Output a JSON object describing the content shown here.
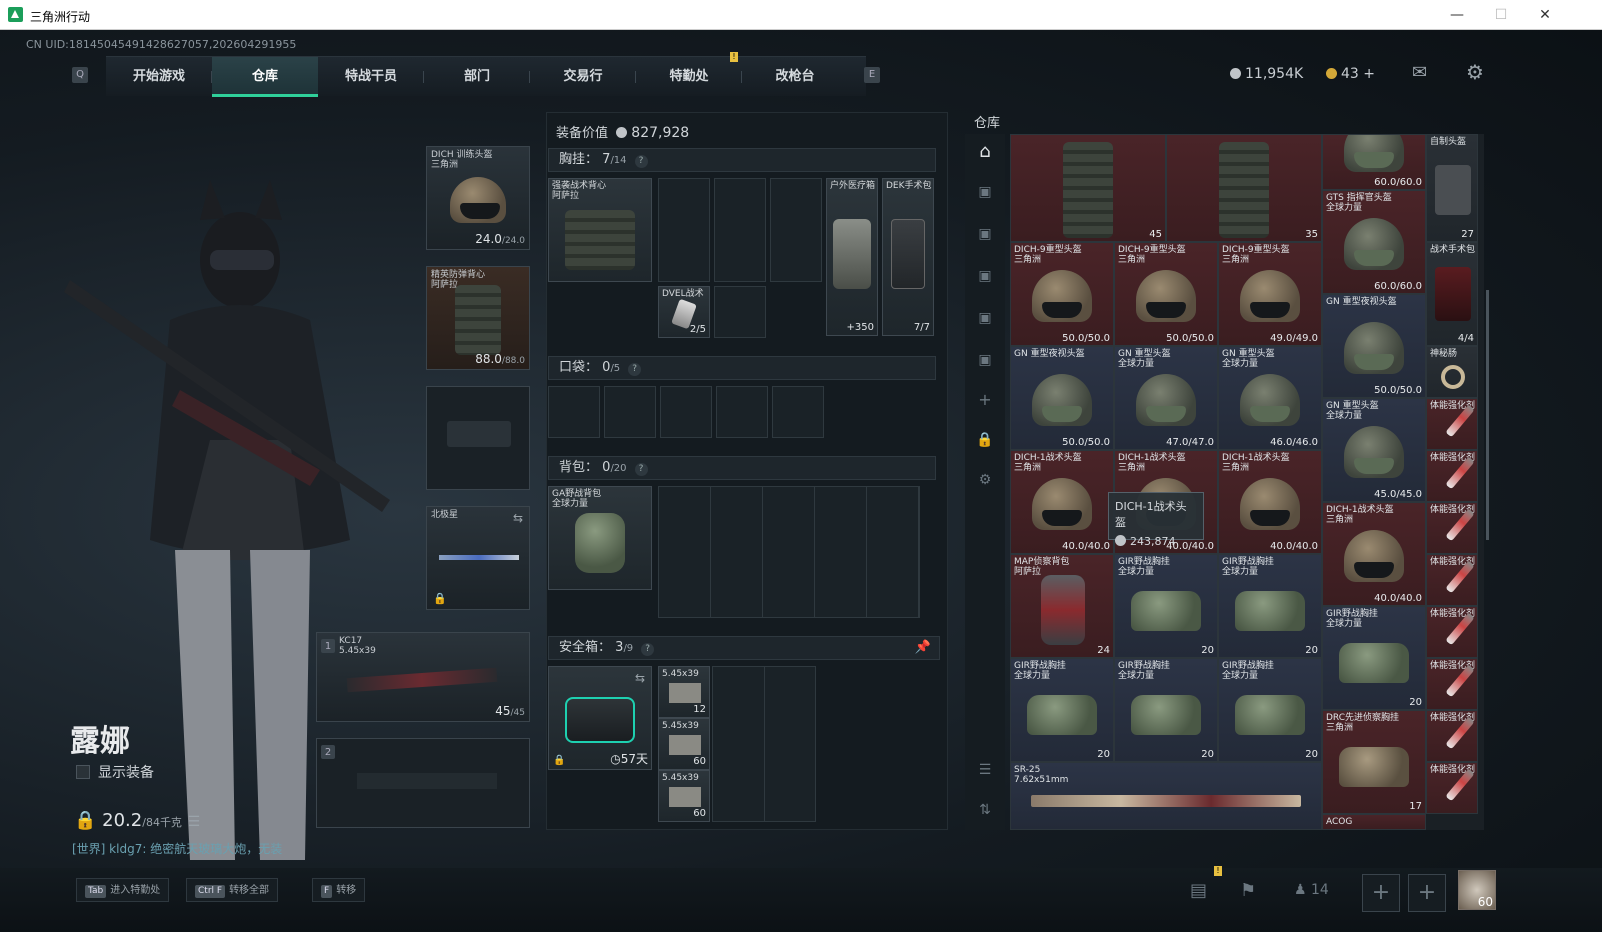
{
  "window": {
    "title": "三角洲行动"
  },
  "uid": "CN UID:1814504549142862705​7,202604291955",
  "nav": {
    "key_left": "Q",
    "key_right": "E",
    "tabs": [
      "开始游戏",
      "仓库",
      "特战干员",
      "部门",
      "交易行",
      "特勤处",
      "改枪台"
    ],
    "active": "仓库"
  },
  "currency": {
    "coins": "11,954K",
    "tickets": "43"
  },
  "character": {
    "name": "露娜",
    "show_equip": "显示装备",
    "weight": "20.2",
    "weight_max": "/84千克",
    "chat": "[世界] kldg7: 绝密航天玻璃大炮，无装"
  },
  "equip_slots": {
    "helmet": {
      "name": "DICH 训练头盔",
      "sub": "三角洲",
      "dur": "24.0",
      "dur_max": "/24.0"
    },
    "armor": {
      "name": "精英防弹背心",
      "sub": "阿萨拉",
      "dur": "88.0",
      "dur_max": "/88.0"
    },
    "melee": {
      "name": "北极星"
    },
    "primary": {
      "num": "1",
      "name": "KC17",
      "caliber": "5.45x39",
      "ammo": "45",
      "ammo_max": "/45"
    },
    "secondary": {
      "num": "2"
    }
  },
  "loadout": {
    "value_label": "装备价值",
    "value": "827,928",
    "chest": {
      "label": "胸挂：",
      "count": "7",
      "max": "/14",
      "rig_name": "强袭战术背心",
      "rig_sub": "阿萨拉",
      "medkit": "户外医疗箱",
      "medkit_val": "350",
      "surgkit": "DEK手术包",
      "surgkit_val": "7/7",
      "battery": "DVEL战术",
      "battery_val": "2/5"
    },
    "pocket": {
      "label": "口袋：",
      "count": "0",
      "max": "/5"
    },
    "backpack": {
      "label": "背包：",
      "count": "0",
      "max": "/20",
      "bag_name": "GA野战背包",
      "bag_sub": "全球力量"
    },
    "safe": {
      "label": "安全箱：",
      "count": "3",
      "max": "/9",
      "days": "57天",
      "ammo": [
        {
          "name": "5.45x39",
          "qty": "12"
        },
        {
          "name": "5.45x39",
          "qty": "60"
        },
        {
          "name": "5.45x39",
          "qty": "60"
        }
      ]
    }
  },
  "warehouse": {
    "title": "仓库",
    "tooltip": {
      "name": "DICH-1战术头盔",
      "value": "243,874"
    },
    "items": [
      {
        "name": "",
        "sub": "",
        "qty": "45"
      },
      {
        "name": "",
        "sub": "",
        "qty": "35"
      },
      {
        "name": "",
        "sub": "",
        "qty": "60.0/60.0"
      },
      {
        "name": "自制头盔",
        "sub": "",
        "qty": "27"
      },
      {
        "name": "GTS 指挥官头盔",
        "sub": "全球力量",
        "qty": "60.0/60.0"
      },
      {
        "name": "战术手术包",
        "sub": "",
        "qty": "4/4"
      },
      {
        "name": "DICH-9重型头盔",
        "sub": "三角洲",
        "qty": "50.0/50.0"
      },
      {
        "name": "DICH-9重型头盔",
        "sub": "三角洲",
        "qty": "50.0/50.0"
      },
      {
        "name": "DICH-9重型头盔",
        "sub": "三角洲",
        "qty": "49.0/49.0"
      },
      {
        "name": "GN 重型夜视头盔",
        "sub": "",
        "qty": "50.0/50.0"
      },
      {
        "name": "神秘肠",
        "sub": "",
        "qty": ""
      },
      {
        "name": "GN 重型夜视头盔",
        "sub": "",
        "qty": "50.0/50.0"
      },
      {
        "name": "GN 重型头盔",
        "sub": "全球力量",
        "qty": "47.0/47.0"
      },
      {
        "name": "GN 重型头盔",
        "sub": "全球力量",
        "qty": "46.0/46.0"
      },
      {
        "name": "GN 重型头盔",
        "sub": "全球力量",
        "qty": "45.0/45.0"
      },
      {
        "name": "体能强化剂",
        "sub": "",
        "qty": ""
      },
      {
        "name": "DICH-1战术头盔",
        "sub": "三角洲",
        "qty": "40.0/40.0"
      },
      {
        "name": "DICH-1战术头盔",
        "sub": "三角洲",
        "qty": "40.0/40.0"
      },
      {
        "name": "DICH-1战术头盔",
        "sub": "三角洲",
        "qty": "40.0/40.0"
      },
      {
        "name": "DICH-1战术头盔",
        "sub": "三角洲",
        "qty": "40.0/40.0"
      },
      {
        "name": "MAP侦察背包",
        "sub": "阿萨拉",
        "qty": "24"
      },
      {
        "name": "GIR野战胸挂",
        "sub": "全球力量",
        "qty": "20"
      },
      {
        "name": "GIR野战胸挂",
        "sub": "全球力量",
        "qty": "20"
      },
      {
        "name": "GIR野战胸挂",
        "sub": "全球力量",
        "qty": "20"
      },
      {
        "name": "GIR野战胸挂",
        "sub": "全球力量",
        "qty": "20"
      },
      {
        "name": "GIR野战胸挂",
        "sub": "全球力量",
        "qty": "20"
      },
      {
        "name": "GIR野战胸挂",
        "sub": "全球力量",
        "qty": "20"
      },
      {
        "name": "DRC先进侦察胸挂",
        "sub": "三角洲",
        "qty": "17"
      },
      {
        "name": "SR-25",
        "sub": "7.62x51mm",
        "qty": ""
      },
      {
        "name": "ACOG",
        "sub": "",
        "qty": ""
      }
    ]
  },
  "bottom": {
    "keys": [
      {
        "k": "Tab",
        "t": "进入特勤处"
      },
      {
        "k": "Ctrl F",
        "t": "转移全部"
      },
      {
        "k": "F",
        "t": "转移"
      }
    ],
    "squad": "14",
    "avatar_level": "60"
  }
}
